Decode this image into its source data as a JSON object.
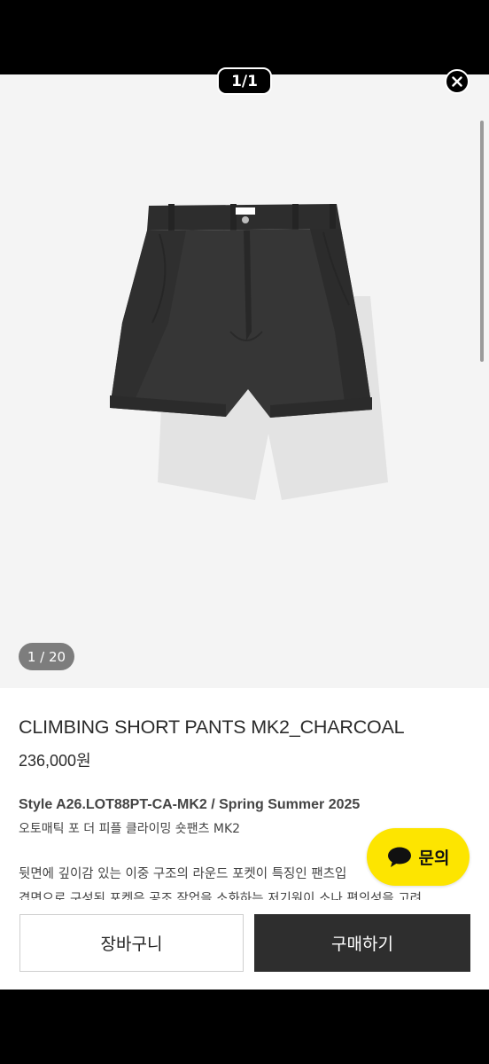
{
  "viewer": {
    "counter": "1/1",
    "close_icon": "close-icon"
  },
  "gallery": {
    "page_indicator": "1 / 20",
    "image_icon": "charcoal-shorts-photo"
  },
  "product": {
    "title": "CLIMBING SHORT PANTS MK2_CHARCOAL",
    "price": "236,000원",
    "style_line": "Style A26.LOT88PT-CA-MK2 / Spring Summer 2025",
    "korean_name": "오토매틱 포 더 피플 클라이밍 숏팬츠 MK2",
    "description_lines": [
      "뒷면에 깊이감 있는 이중 구조의 라운드 포켓이 특징인 팬츠입",
      "겹면으로 구성된 포켓은 공조 작업을 소화하는 저기원이 소나 편의성을 고려"
    ]
  },
  "inquiry": {
    "label": "문의",
    "icon": "chat-bubble-icon",
    "color": "#fde500"
  },
  "actions": {
    "cart_label": "장바구니",
    "buy_label": "구매하기"
  },
  "colors": {
    "buy_button": "#2e2e2e",
    "image_background": "#f4f4f4"
  }
}
